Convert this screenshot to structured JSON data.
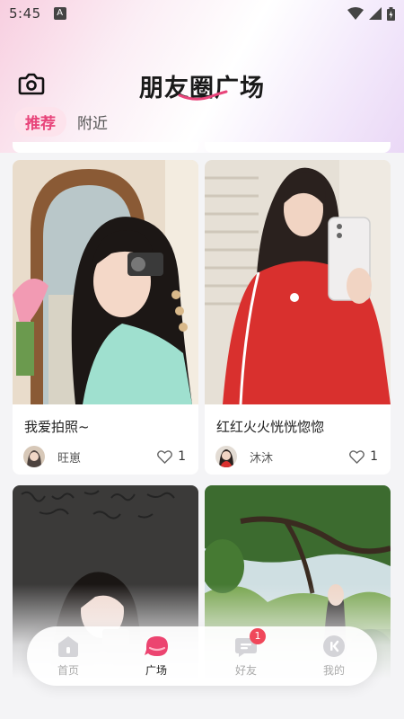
{
  "status_bar": {
    "time": "5:45",
    "notification_letter": "A"
  },
  "header": {
    "title": "朋友圈广场",
    "camera_icon": "camera-icon"
  },
  "tabs": [
    {
      "label": "推荐",
      "active": true
    },
    {
      "label": "附近",
      "active": false
    }
  ],
  "posts": [
    {
      "title": "我爱拍照~",
      "author": "旺崽",
      "likes": "1"
    },
    {
      "title": "红红火火恍恍惚惚",
      "author": "沐沐",
      "likes": "1"
    },
    {
      "title": "",
      "author": "",
      "likes": ""
    },
    {
      "title": "",
      "author": "",
      "likes": ""
    }
  ],
  "nav": {
    "items": [
      {
        "label": "首页",
        "icon": "home-icon"
      },
      {
        "label": "广场",
        "icon": "plaza-icon",
        "active": true
      },
      {
        "label": "好友",
        "icon": "chat-icon",
        "badge": "1"
      },
      {
        "label": "我的",
        "icon": "profile-icon"
      }
    ]
  },
  "colors": {
    "accent": "#e8447a",
    "badge": "#f0475a"
  }
}
